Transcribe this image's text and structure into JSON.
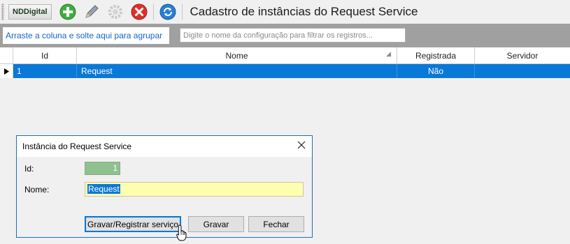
{
  "toolbar": {
    "brand_label": "NDDigital",
    "title": "Cadastro de instâncias do Request Service",
    "icons": [
      "add-icon",
      "edit-pencil-icon",
      "settings-gear-icon",
      "delete-icon",
      "refresh-icon"
    ]
  },
  "groupbar": {
    "hint": "Arraste a coluna e solte aqui para agrupar",
    "filter_placeholder": "Digite o nome da configuração para filtrar os registros..."
  },
  "grid": {
    "columns": [
      "Id",
      "Nome",
      "Registrada",
      "Servidor"
    ],
    "rows": [
      {
        "id": "1",
        "nome": "Request",
        "registrada": "Não",
        "servidor": ""
      }
    ]
  },
  "dialog": {
    "title": "Instância do Request Service",
    "id_label": "Id:",
    "id_value": "1",
    "name_label": "Nome:",
    "name_value": "Request",
    "btn_register": "Gravar/Registrar serviço",
    "btn_save": "Gravar",
    "btn_close": "Fechar"
  },
  "colors": {
    "selection": "#0a78d7",
    "name_field_bg": "#ffffb0",
    "id_field_bg": "#8fc18f",
    "group_hint_text": "#1565c0"
  }
}
